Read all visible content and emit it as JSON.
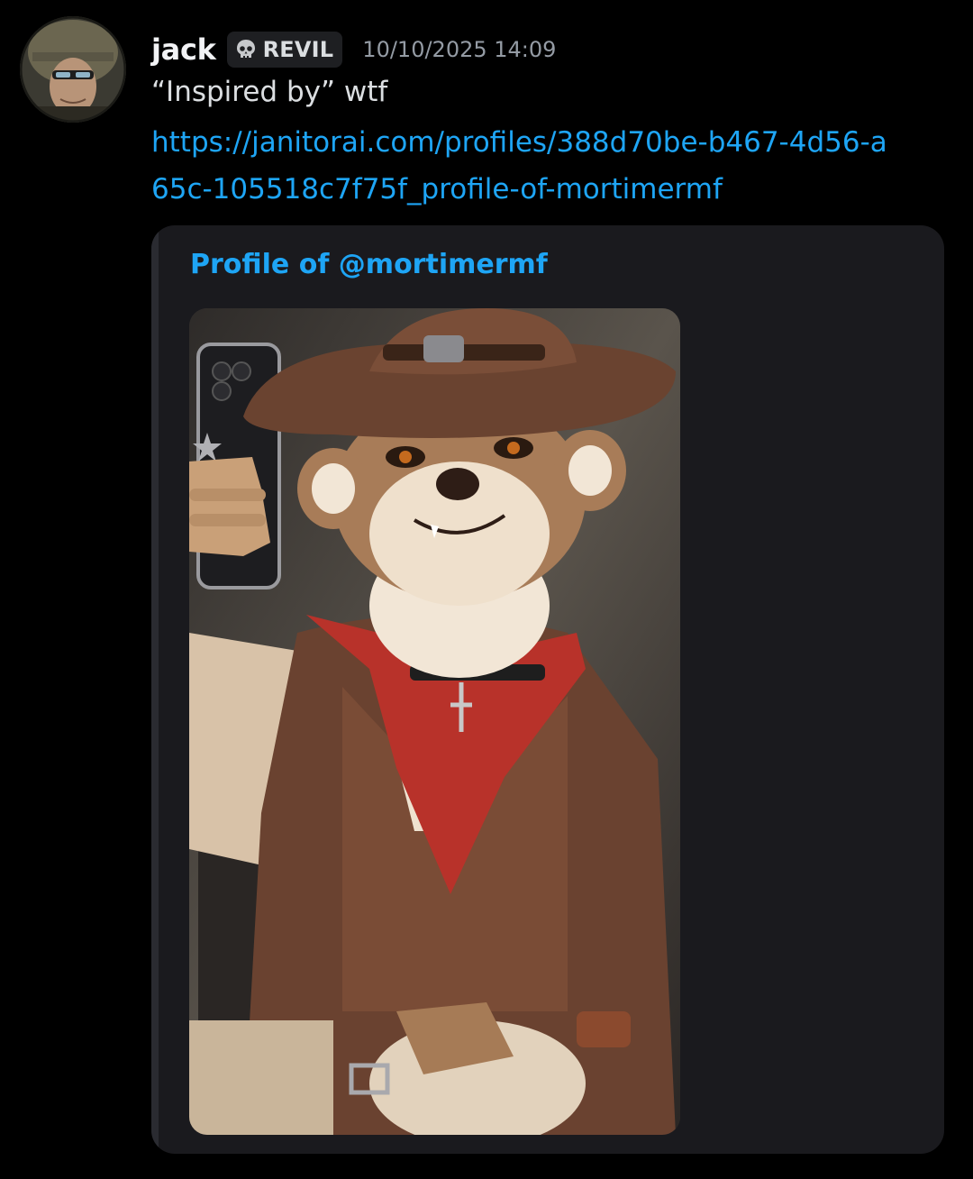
{
  "message": {
    "author": {
      "username": "jack",
      "avatar_icon": "soldier-avatar"
    },
    "tag": {
      "icon": "skull-icon",
      "label": "REVIL"
    },
    "timestamp": "10/10/2025 14:09",
    "text": "“Inspired by” wtf",
    "link": "https://janitorai.com/profiles/388d70be-b467-4d56-a65c-105518c7f75f_profile-of-mortimermf",
    "embed": {
      "title": "Profile of @mortimermf",
      "image_description": "cowboy-furry-selfie"
    }
  },
  "colors": {
    "background": "#000000",
    "link": "#1ea5f5",
    "embed_background": "#1a1a1e"
  }
}
